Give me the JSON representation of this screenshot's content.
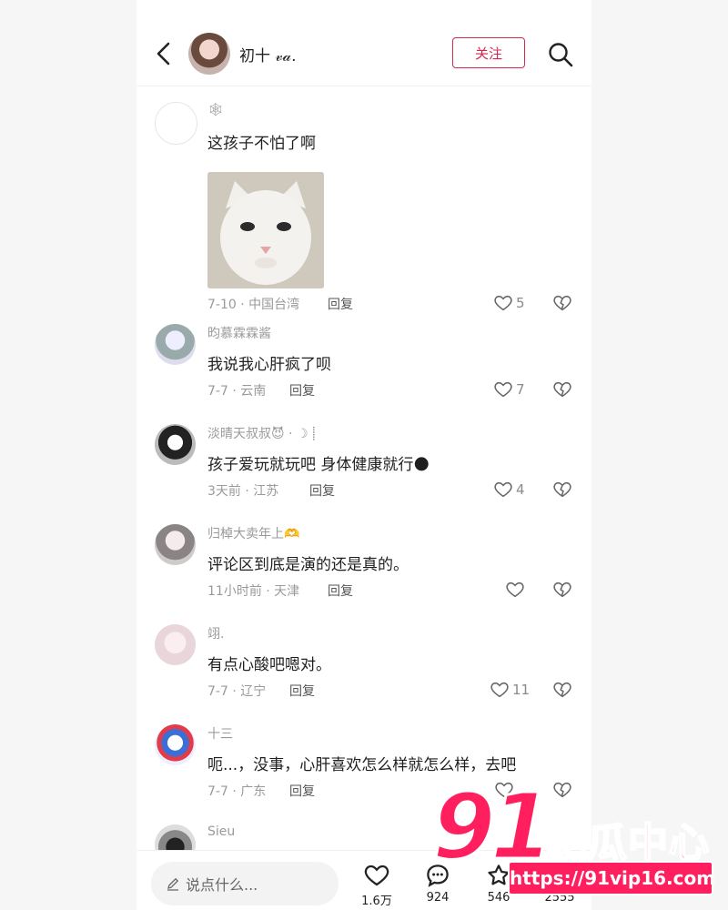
{
  "header": {
    "user_name": "初十 𝓋𝒶.",
    "follow_label": "关注"
  },
  "comments": [
    {
      "name": "🕸",
      "text": "这孩子不怕了啊",
      "date": "7-10 · 中国台湾",
      "reply": "回复",
      "likes": "5",
      "has_image": true
    },
    {
      "name": "昀慕霖霖酱",
      "text": "我说我心肝疯了呗",
      "date": "7-7 · 云南",
      "reply": "回复",
      "likes": "7"
    },
    {
      "name": "淡晴天叔叔😈 · ☽ ⸽",
      "text": "孩子爱玩就玩吧 身体健康就行🌑",
      "date": "3天前 · 江苏",
      "reply": "回复",
      "likes": "4"
    },
    {
      "name": "归棹大卖年上🫶",
      "text": "评论区到底是演的还是真的。",
      "date": "11小时前 · 天津",
      "reply": "回复",
      "likes": ""
    },
    {
      "name": "翊.",
      "text": "有点心酸吧嗯对。",
      "date": "7-7 · 辽宁",
      "reply": "回复",
      "likes": "11"
    },
    {
      "name": "十三",
      "text": "呃...，没事，心肝喜欢怎么样就怎么样，去吧",
      "date": "7-7 · 广东",
      "reply": "回复",
      "likes": ""
    },
    {
      "name": "Sieu"
    }
  ],
  "bottom_bar": {
    "input_placeholder": "说点什么...",
    "like_count": "1.6万",
    "comment_count": "924",
    "collect_count": "546",
    "share_count": "2555"
  },
  "watermark": {
    "logo_number": "91",
    "logo_text": "吃瓜中心",
    "url": "https://91vip16.com"
  },
  "colors": {
    "accent": "#d6274f",
    "watermark": "#ff1f5e"
  },
  "icons": [
    "back-icon",
    "search-icon",
    "heart-icon",
    "broken-heart-icon",
    "pencil-icon",
    "chat-icon",
    "star-icon",
    "share-icon"
  ]
}
